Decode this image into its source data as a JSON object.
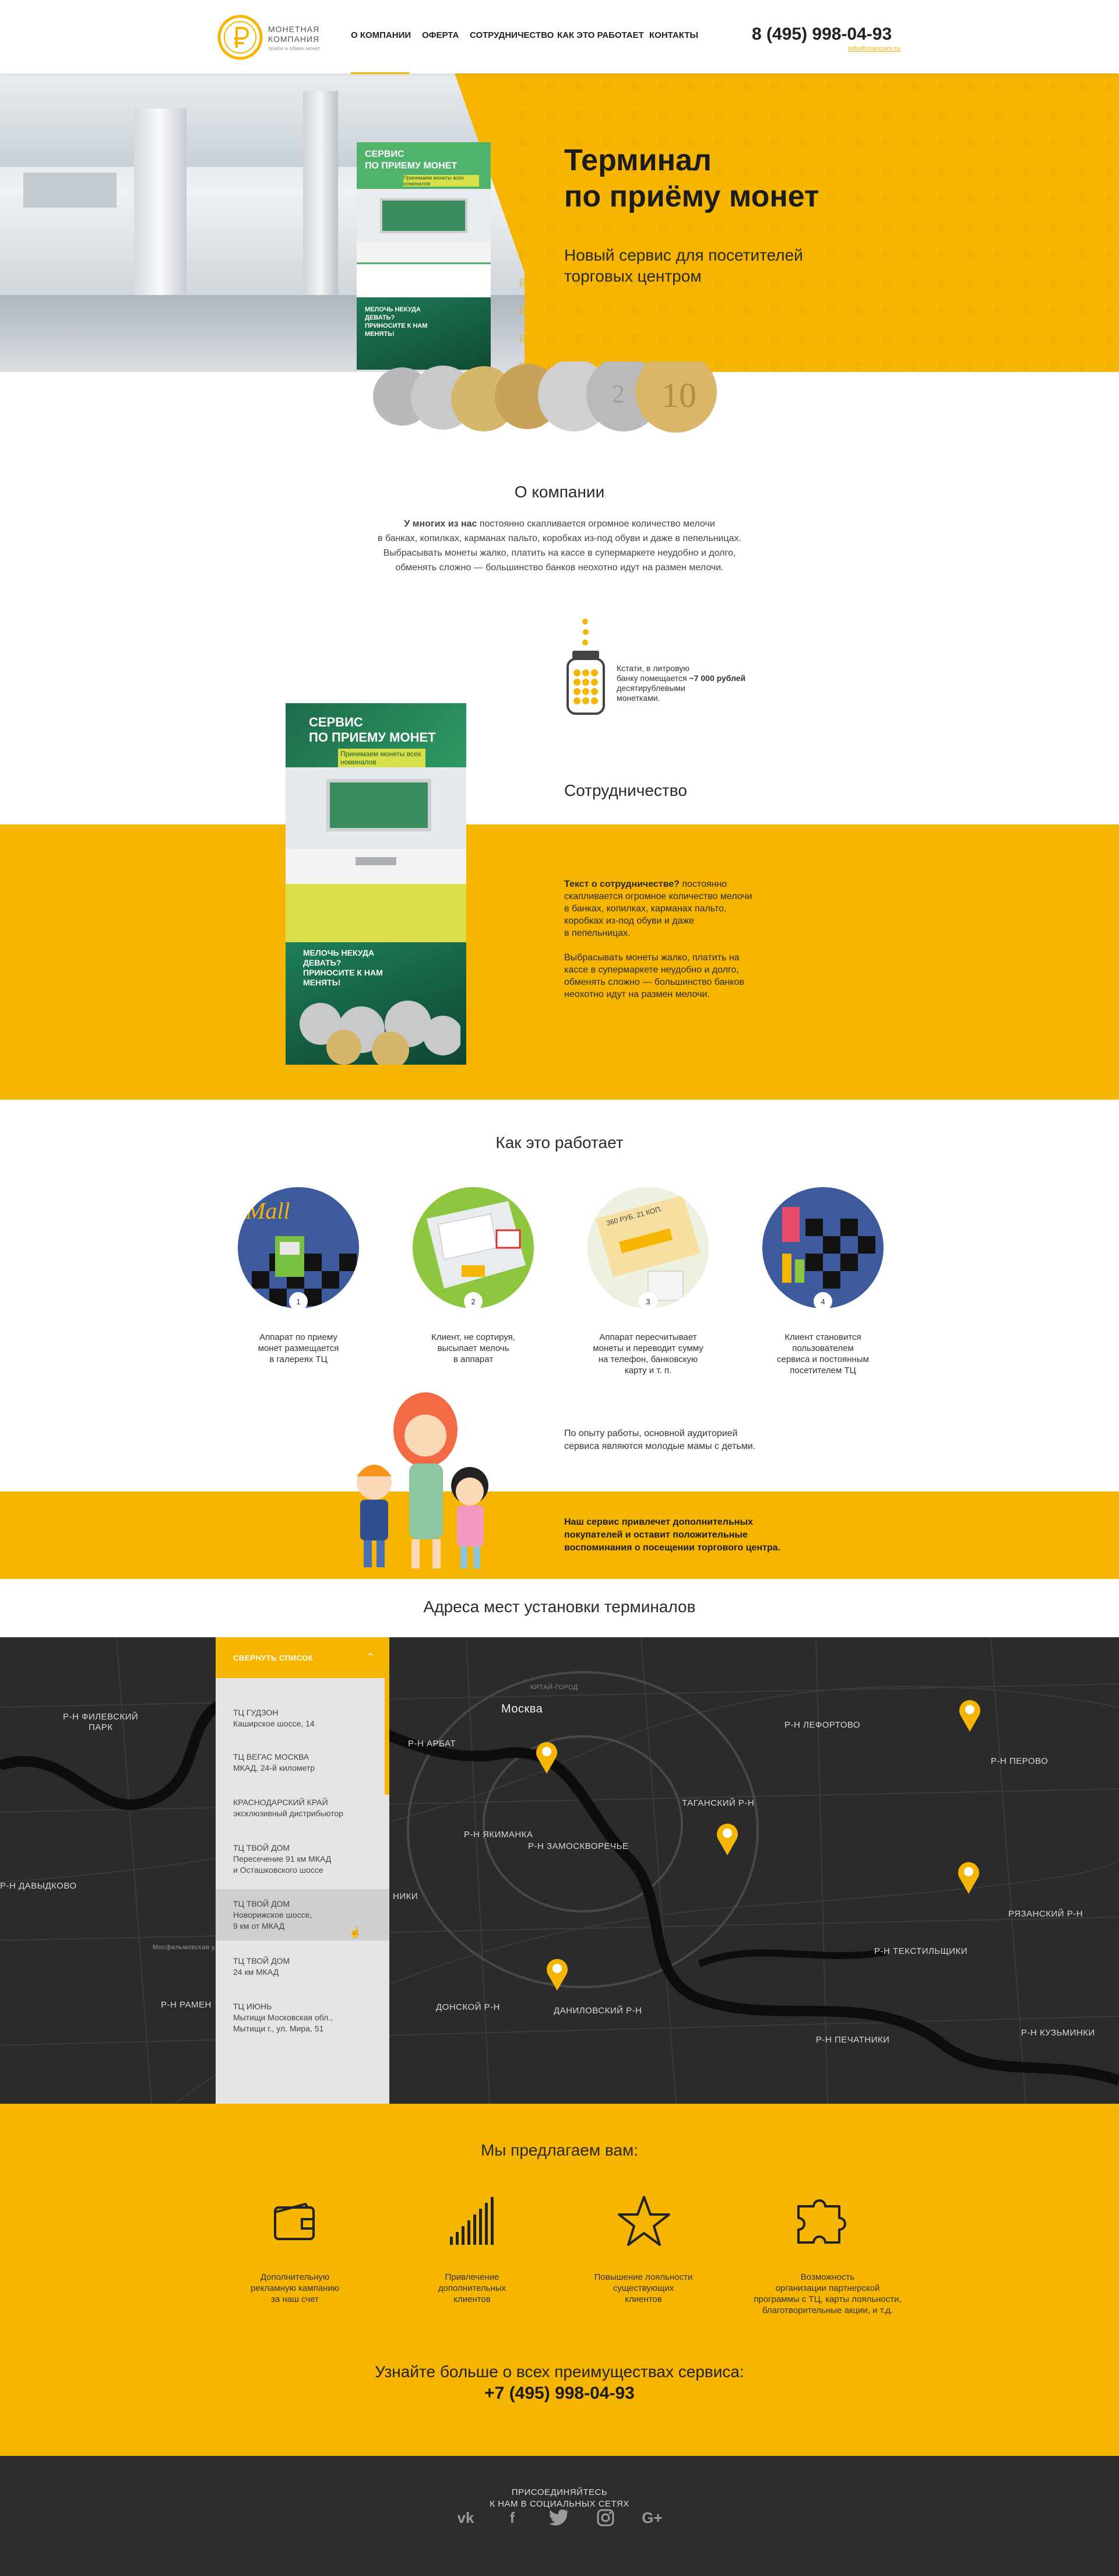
{
  "brand": {
    "name_line1": "МОНЕТНАЯ",
    "name_line2": "КОМПАНИЯ",
    "tagline": "приём и обмен монет"
  },
  "nav": [
    "О КОМПАНИИ",
    "ОФЕРТА",
    "СОТРУДНИЧЕСТВО",
    "КАК ЭТО РАБОТАЕТ",
    "КОНТАКТЫ"
  ],
  "contact": {
    "phone": "8 (495) 998-04-93",
    "email": "info@coincom.ru"
  },
  "hero": {
    "title_line1": "Терминал",
    "title_line2": "по приёму монет",
    "subtitle_line1": "Новый сервис для посетителей",
    "subtitle_line2": "торговых центром",
    "terminal_label_1": "СЕРВИС",
    "terminal_label_2": "ПО ПРИЕМУ МОНЕТ",
    "terminal_sub": "Принимаем монеты всех номиналов",
    "terminal_slogan": "МЕЛОЧЬ НЕКУДА ДЕВАТЬ? ПРИНОСИТЕ К НАМ МЕНЯТЬ!"
  },
  "about": {
    "title": "О компании",
    "lead_bold": "У многих из нас",
    "line1": "постоянно скапливается огромное количество мелочи",
    "line2": "в банках, копилках, карманах пальто, коробках из-под обуви и даже в пепельницах.",
    "line3": "Выбрасывать монеты жалко, платить на кассе в супермаркете неудобно и долго,",
    "line4": "обменять сложно — большинство банков неохотно идут на размен мелочи.",
    "jar_note_1": "Кстати, в литровую",
    "jar_note_2": "банку помещается",
    "jar_note_bold": "~7 000 рублей",
    "jar_note_3": "десятирублевыми",
    "jar_note_4": "монетками."
  },
  "cooperation": {
    "title": "Сотрудничество",
    "p1_bold": "Текст о сотрудничестве?",
    "p1_rest_1": "постоянно",
    "p1_rest_2": "скапливается огромное количество мелочи",
    "p1_rest_3": "в банках, копилках, карманах пальто,",
    "p1_rest_4": "коробках из-под обуви и даже",
    "p1_rest_5": "в пепельницах.",
    "p2_1": "Выбрасывать монеты жалко, платить на",
    "p2_2": "кассе в супермаркете неудобно и долго,",
    "p2_3": "обменять сложно — большинство банков",
    "p2_4": "неохотно идут на размен мелочи."
  },
  "how": {
    "title": "Как это работает",
    "steps": [
      {
        "num": "1",
        "l1": "Аппарат по приему",
        "l2": "монет размещается",
        "l3": "в галереях ТЦ",
        "l4": ""
      },
      {
        "num": "2",
        "l1": "Клиент, не сортируя,",
        "l2": "высыпает мелочь",
        "l3": "в аппарат",
        "l4": ""
      },
      {
        "num": "3",
        "l1": "Аппарат пересчитывает",
        "l2": "монеты и переводит сумму",
        "l3": "на телефон, банковскую",
        "l4": "карту и т. п."
      },
      {
        "num": "4",
        "l1": "Клиент становится",
        "l2": "пользователем",
        "l3": "сервиса и постоянным",
        "l4": "посетителем ТЦ"
      }
    ],
    "sign_text": "360 РУБ. 21 КОП.",
    "mall_sign": "Mall"
  },
  "audience": {
    "line1": "По опыту работы, основной аудиторией",
    "line2": "сервиса являются молодые мамы с детьми.",
    "bold1": "Наш сервис привлечет дополнительных",
    "bold2": "покупателей и оставит положительные",
    "bold3": "воспоминания о посещении торгового центра."
  },
  "map": {
    "title": "Адреса мест установки терминалов",
    "panel_header": "СВЕРНУТЬ СПИСОК",
    "locations": [
      {
        "name": "ТЦ ГУДЗОН",
        "addr1": "Каширское шоссе, 14",
        "addr2": ""
      },
      {
        "name": "ТЦ ВЕГАС МОСКВА",
        "addr1": "МКАД, 24-й километр",
        "addr2": ""
      },
      {
        "name": "КРАСНОДАРСКИЙ КРАЙ",
        "addr1": "эксклюзивный дистрибьютор",
        "addr2": ""
      },
      {
        "name": "ТЦ ТВОЙ ДОМ",
        "addr1": "Пересечение 91 км МКАД",
        "addr2": "и Осташковского шоссе"
      },
      {
        "name": "ТЦ ТВОЙ ДОМ",
        "addr1": "Новорижское шоссе,",
        "addr2": "9 км от МКАД"
      },
      {
        "name": "ТЦ ТВОЙ ДОМ",
        "addr1": "24 км МКАД",
        "addr2": ""
      },
      {
        "name": "ТЦ ИЮНЬ",
        "addr1": "Мытищи Московская обл.,",
        "addr2": "Мытищи г., ул. Мира, 51"
      }
    ],
    "labels": {
      "moskva": "Москва",
      "kitay": "КИТАЙ-ГОРОД",
      "filevsky": "Р-Н ФИЛЕВСКИЙ",
      "park": "ПАРК",
      "arbat": "Р-Н АРБАТ",
      "lefortovo": "Р-Н ЛЕФОРТОВО",
      "perovo": "Р-Н ПЕРОВО",
      "yakimanka": "Р-Н ЯКИМАНКА",
      "zamosk": "Р-Н ЗАМОСКВОРЕЧЬЕ",
      "tagansky": "ТАГАНСКИЙ Р-Н",
      "davydkovo": "Р-Н ДАВЫДКОВО",
      "niki": "НИКИ",
      "ryazansky": "РЯЗАНСКИЙ Р-Н",
      "tekstil": "Р-Н ТЕКСТИЛЬЩИКИ",
      "ramen": "Р-Н РАМЕН",
      "donskoy": "ДОНСКОЙ Р-Н",
      "danilov": "ДАНИЛОВСКИЙ Р-Н",
      "pechatniki": "Р-Н ПЕЧАТНИКИ",
      "kuzminki": "Р-Н КУЗЬМИНКИ",
      "mosfilm": "Мосфильмовская улица"
    }
  },
  "offer": {
    "title": "Мы предлагаем вам:",
    "items": [
      {
        "icon": "wallet-icon",
        "l1": "Дополнительную",
        "l2": "рекламную кампанию",
        "l3": "за наш счет",
        "l4": ""
      },
      {
        "icon": "bars-chart-icon",
        "l1": "Привлечение",
        "l2": "дополнительных",
        "l3": "клиентов",
        "l4": ""
      },
      {
        "icon": "star-icon",
        "l1": "Повышение лояльности",
        "l2": "существующих",
        "l3": "клиентов",
        "l4": ""
      },
      {
        "icon": "puzzle-icon",
        "l1": "Возможность",
        "l2": "организации партнерской",
        "l3": "программы с ТЦ, карты лояльности,",
        "l4": "благотворительные акции, и т.д."
      }
    ],
    "cta_line1": "Узнайте больше о всех преимуществах сервиса:",
    "cta_phone": "+7 (495) 998-04-93"
  },
  "footer": {
    "line1": "ПРИСОЕДИНЯЙТЕСЬ",
    "line2": "К НАМ В СОЦИАЛЬНЫХ СЕТЯХ",
    "socials": [
      {
        "name": "vk-icon",
        "glyph": "vk"
      },
      {
        "name": "facebook-icon",
        "glyph": "f"
      },
      {
        "name": "twitter-icon",
        "glyph": "t"
      },
      {
        "name": "instagram-icon",
        "glyph": "◎"
      },
      {
        "name": "google-plus-icon",
        "glyph": "G+"
      }
    ]
  },
  "colors": {
    "accent": "#f5b501",
    "dark": "#2c2c2c",
    "map_bg": "#2b2b2b",
    "panel_bg": "#e4e4e4"
  }
}
